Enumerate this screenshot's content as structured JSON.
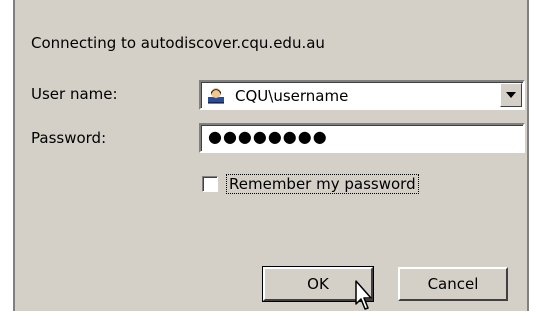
{
  "dialog": {
    "connecting_text": "Connecting to autodiscover.cqu.edu.au",
    "user_label": "User name:",
    "password_label": "Password:",
    "user_value": "CQU\\username",
    "password_value": "●●●●●●●●",
    "remember_label": "Remember my password",
    "remember_checked": false,
    "ok_label": "OK",
    "cancel_label": "Cancel"
  },
  "colors": {
    "dialog_bg": "#d4d0c8",
    "field_bg": "#ffffff"
  },
  "icons": {
    "user": "user-icon",
    "dropdown": "chevron-down-icon",
    "cursor": "mouse-cursor-icon"
  }
}
